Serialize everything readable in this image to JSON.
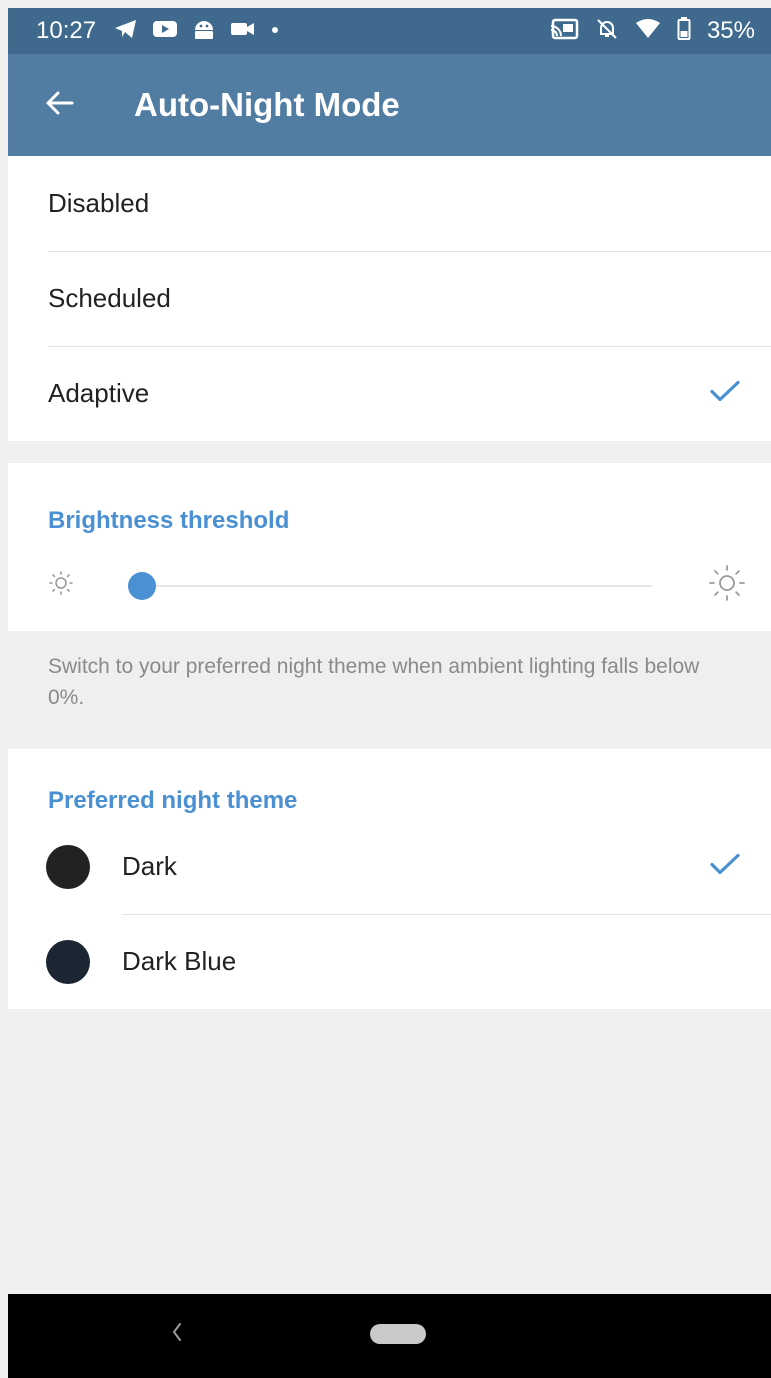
{
  "status_bar": {
    "time": "10:27",
    "battery": "35%",
    "left_icons": [
      "telegram-icon",
      "youtube-icon",
      "android-icon",
      "video-icon",
      "dot-icon"
    ],
    "right_icons": [
      "cast-icon",
      "notifications-off-icon",
      "wifi-icon",
      "battery-icon"
    ]
  },
  "app_bar": {
    "title": "Auto-Night Mode",
    "background": "#527da3",
    "status_background": "#3f6a8e"
  },
  "mode_options": [
    {
      "label": "Disabled",
      "selected": false
    },
    {
      "label": "Scheduled",
      "selected": false
    },
    {
      "label": "Adaptive",
      "selected": true
    }
  ],
  "brightness": {
    "title": "Brightness threshold",
    "value_percent": 0,
    "description": "Switch to your preferred night theme when ambient lighting falls below 0%."
  },
  "night_theme": {
    "title": "Preferred night theme",
    "options": [
      {
        "label": "Dark",
        "color": "#222222",
        "selected": true
      },
      {
        "label": "Dark Blue",
        "color": "#1c2633",
        "selected": false
      }
    ]
  },
  "accent_color": "#4a90d2"
}
